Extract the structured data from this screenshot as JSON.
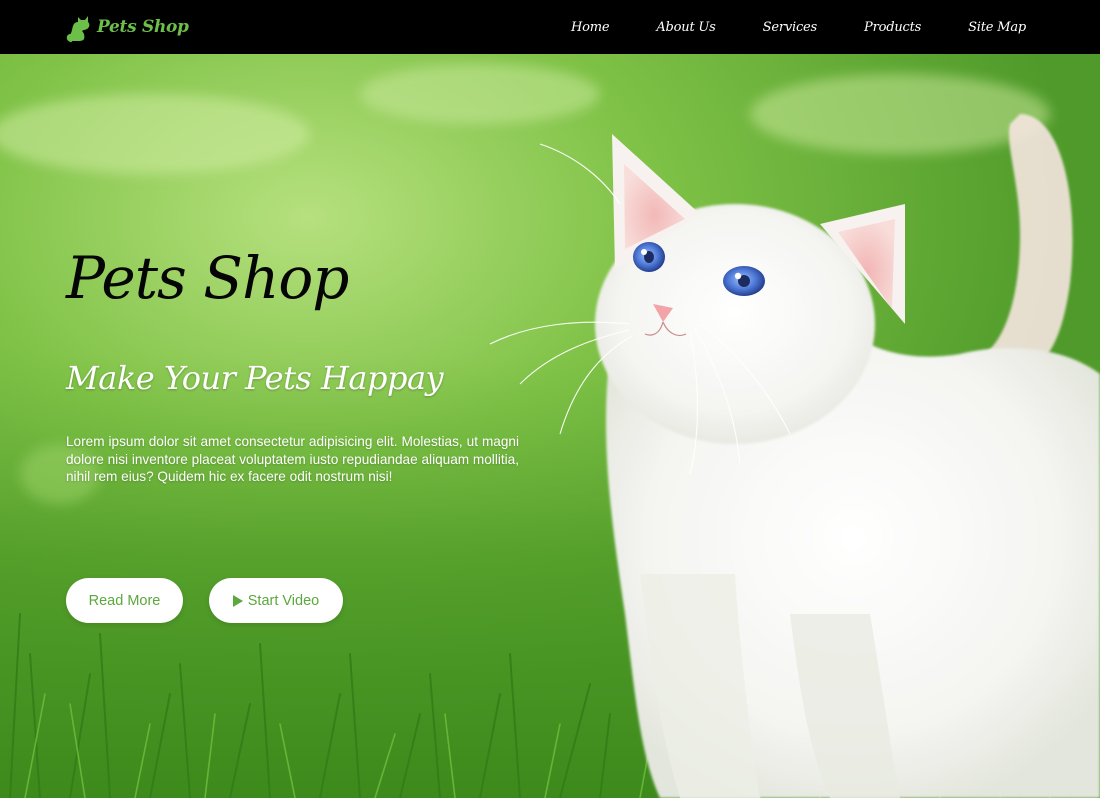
{
  "colors": {
    "accent": "#5ca83c",
    "brand": "#6cc04a",
    "navbar_bg": "#000000"
  },
  "header": {
    "brand_icon": "cat-logo-icon",
    "brand_name": "Pets Shop",
    "nav": [
      {
        "label": "Home"
      },
      {
        "label": "About Us"
      },
      {
        "label": "Services"
      },
      {
        "label": "Products"
      },
      {
        "label": "Site Map"
      }
    ]
  },
  "hero": {
    "image": "white-kitten-on-grass",
    "title": "Pets Shop",
    "subtitle": "Make Your Pets Happay",
    "text": "Lorem ipsum dolor sit amet consectetur adipisicing elit. Molestias, ut magni dolore nisi inventore placeat voluptatem iusto repudiandae aliquam mollitia, nihil rem eius? Quidem hic ex facere odit nostrum nisi!",
    "read_more_label": "Read More",
    "video_icon": "play-icon",
    "start_video_label": "Start Video"
  }
}
